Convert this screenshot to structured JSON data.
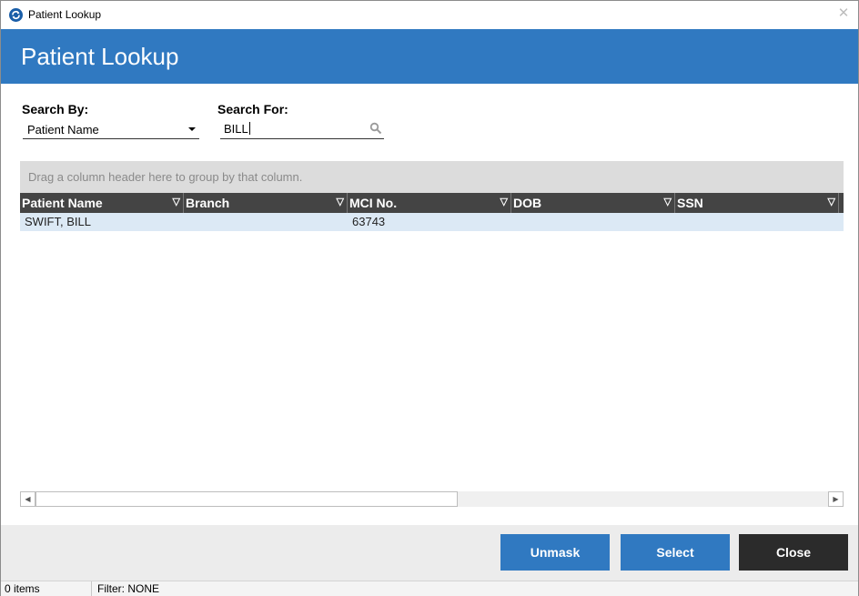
{
  "window": {
    "title": "Patient Lookup",
    "close_glyph": "✕",
    "app_icon": "refresh-circle-icon"
  },
  "banner": {
    "title": "Patient Lookup"
  },
  "search": {
    "by_label": "Search By:",
    "by_value": "Patient Name",
    "for_label": "Search For:",
    "for_value": "BILL",
    "search_icon": "magnifier-icon"
  },
  "grid": {
    "group_hint": "Drag a column header here to group by that column.",
    "columns": [
      {
        "label": "Patient Name"
      },
      {
        "label": "Branch"
      },
      {
        "label": "MCI No."
      },
      {
        "label": "DOB"
      },
      {
        "label": "SSN"
      }
    ],
    "filter_glyph": "▽",
    "rows": [
      {
        "patient_name": "SWIFT, BILL",
        "branch": "",
        "mci_no": "63743",
        "dob": "",
        "ssn": ""
      }
    ]
  },
  "buttons": {
    "unmask": "Unmask",
    "select": "Select",
    "close": "Close"
  },
  "status": {
    "count": "0 items",
    "filter": "Filter: NONE"
  },
  "colors": {
    "accent": "#3079c1",
    "header_bg": "#444444",
    "row_selected": "#dce9f5",
    "close_button": "#2b2b2b"
  }
}
